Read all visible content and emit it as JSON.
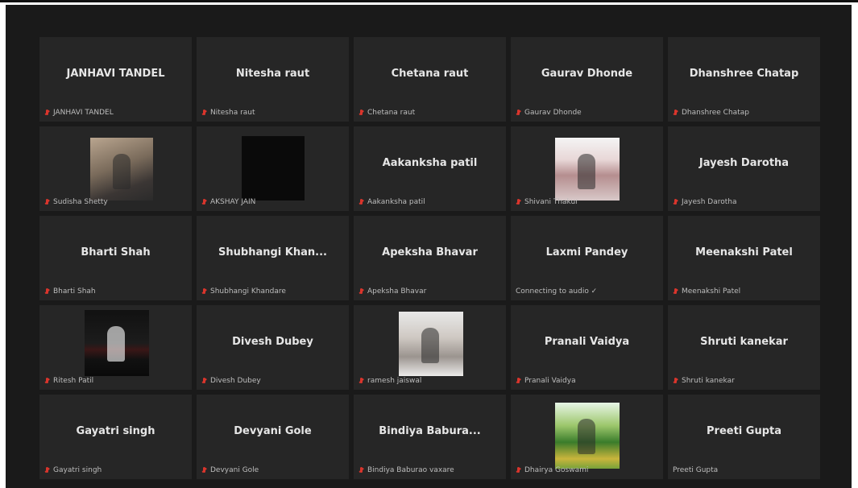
{
  "tiles": [
    {
      "name": "JANHAVI TANDEL",
      "caption": "JANHAVI TANDEL",
      "muted": true
    },
    {
      "name": "Nitesha raut",
      "caption": "Nitesha raut",
      "muted": true
    },
    {
      "name": "Chetana raut",
      "caption": "Chetana raut",
      "muted": true
    },
    {
      "name": "Gaurav Dhonde",
      "caption": "Gaurav Dhonde",
      "muted": true
    },
    {
      "name": "Dhanshree Chatap",
      "caption": "Dhanshree Chatap",
      "muted": true
    },
    {
      "name": "",
      "caption": "Sudisha Shetty",
      "muted": true,
      "photo": "sudisha"
    },
    {
      "name": "",
      "caption": "AKSHAY JAIN",
      "muted": true,
      "photo": "akshay"
    },
    {
      "name": "Aakanksha patil",
      "caption": "Aakanksha patil",
      "muted": true
    },
    {
      "name": "",
      "caption": "Shivani Thakur",
      "muted": true,
      "photo": "shivani"
    },
    {
      "name": "Jayesh Darotha",
      "caption": "Jayesh Darotha",
      "muted": true
    },
    {
      "name": "Bharti Shah",
      "caption": "Bharti Shah",
      "muted": true
    },
    {
      "name": "Shubhangi  Khan...",
      "caption": "Shubhangi Khandare",
      "muted": true
    },
    {
      "name": "Apeksha Bhavar",
      "caption": "Apeksha Bhavar",
      "muted": true
    },
    {
      "name": "Laxmi Pandey",
      "caption": "Connecting to audio ✓",
      "muted": false
    },
    {
      "name": "Meenakshi  Patel",
      "caption": "Meenakshi  Patel",
      "muted": true
    },
    {
      "name": "",
      "caption": "Ritesh Patil",
      "muted": true,
      "photo": "ritesh"
    },
    {
      "name": "Divesh Dubey",
      "caption": "Divesh Dubey",
      "muted": true
    },
    {
      "name": "",
      "caption": "ramesh jaiswal",
      "muted": true,
      "photo": "ramesh"
    },
    {
      "name": "Pranali Vaidya",
      "caption": "Pranali Vaidya",
      "muted": true
    },
    {
      "name": "Shruti kanekar",
      "caption": "Shruti kanekar",
      "muted": true
    },
    {
      "name": "Gayatri singh",
      "caption": "Gayatri singh",
      "muted": true
    },
    {
      "name": "Devyani Gole",
      "caption": "Devyani Gole",
      "muted": true
    },
    {
      "name": "Bindiya  Babura...",
      "caption": "Bindiya Baburao vaxare",
      "muted": true
    },
    {
      "name": "",
      "caption": "Dhairya Goswami",
      "muted": true,
      "photo": "dhairya"
    },
    {
      "name": "Preeti Gupta",
      "caption": "Preeti Gupta",
      "muted": false
    }
  ],
  "colors": {
    "background": "#1a1a1a",
    "tile": "#262626",
    "mic_muted": "#d9352c"
  },
  "icons": {
    "muted": "mic-muted-icon"
  }
}
